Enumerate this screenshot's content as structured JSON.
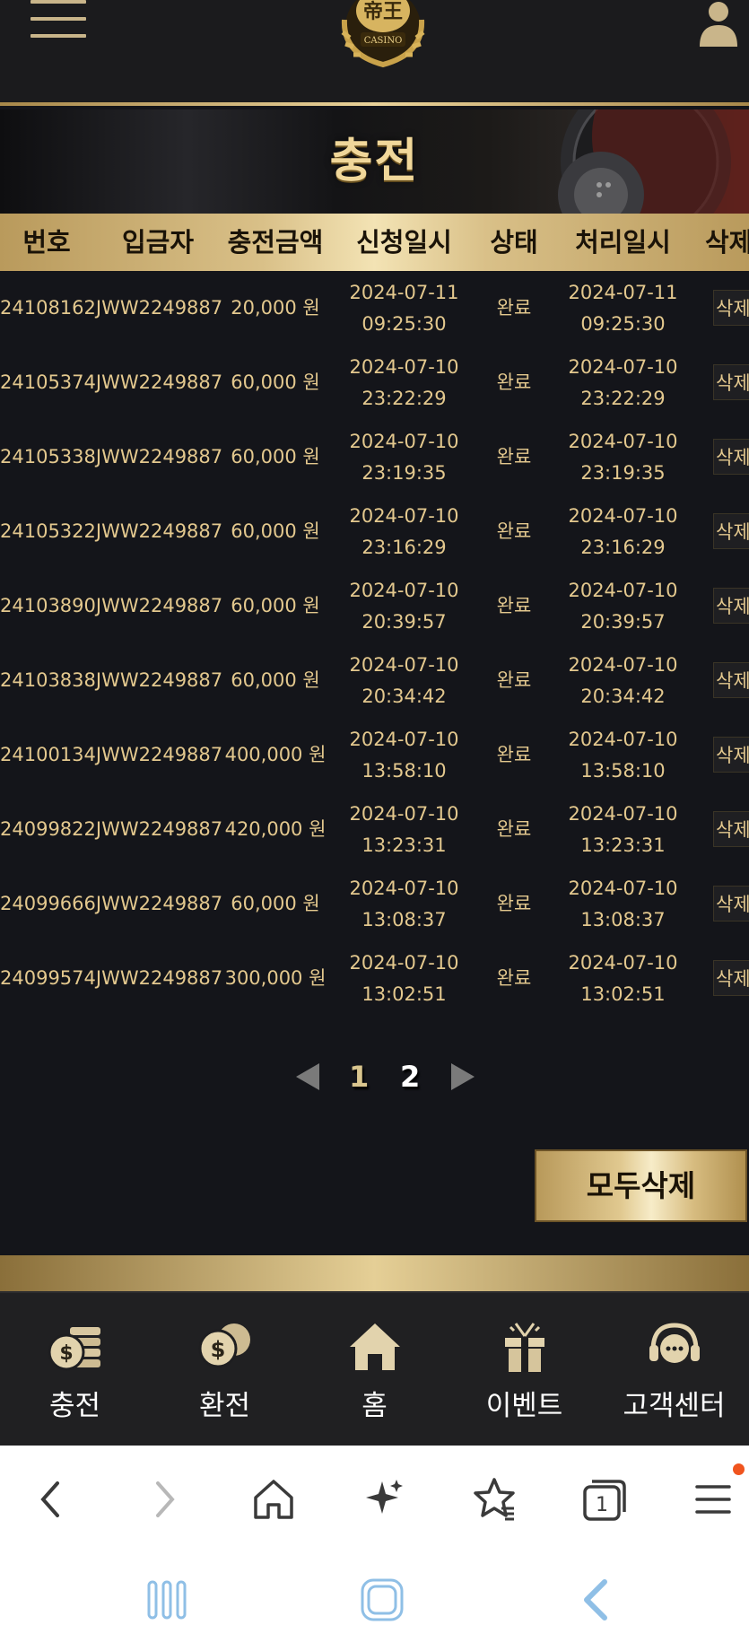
{
  "header": {
    "logo_text": "CASINO"
  },
  "banner": {
    "title": "충전"
  },
  "table": {
    "headers": [
      "번호",
      "입금자",
      "충전금액",
      "신청일시",
      "상태",
      "처리일시",
      "삭제"
    ],
    "rows": [
      {
        "id": "24108162JWW2249887",
        "amount": "20,000 원",
        "req_date": "2024-07-11",
        "req_time": "09:25:30",
        "status": "완료",
        "proc_date": "2024-07-11",
        "proc_time": "09:25:30",
        "delete": "삭제"
      },
      {
        "id": "24105374JWW2249887",
        "amount": "60,000 원",
        "req_date": "2024-07-10",
        "req_time": "23:22:29",
        "status": "완료",
        "proc_date": "2024-07-10",
        "proc_time": "23:22:29",
        "delete": "삭제"
      },
      {
        "id": "24105338JWW2249887",
        "amount": "60,000 원",
        "req_date": "2024-07-10",
        "req_time": "23:19:35",
        "status": "완료",
        "proc_date": "2024-07-10",
        "proc_time": "23:19:35",
        "delete": "삭제"
      },
      {
        "id": "24105322JWW2249887",
        "amount": "60,000 원",
        "req_date": "2024-07-10",
        "req_time": "23:16:29",
        "status": "완료",
        "proc_date": "2024-07-10",
        "proc_time": "23:16:29",
        "delete": "삭제"
      },
      {
        "id": "24103890JWW2249887",
        "amount": "60,000 원",
        "req_date": "2024-07-10",
        "req_time": "20:39:57",
        "status": "완료",
        "proc_date": "2024-07-10",
        "proc_time": "20:39:57",
        "delete": "삭제"
      },
      {
        "id": "24103838JWW2249887",
        "amount": "60,000 원",
        "req_date": "2024-07-10",
        "req_time": "20:34:42",
        "status": "완료",
        "proc_date": "2024-07-10",
        "proc_time": "20:34:42",
        "delete": "삭제"
      },
      {
        "id": "24100134JWW2249887",
        "amount": "400,000 원",
        "req_date": "2024-07-10",
        "req_time": "13:58:10",
        "status": "완료",
        "proc_date": "2024-07-10",
        "proc_time": "13:58:10",
        "delete": "삭제"
      },
      {
        "id": "24099822JWW2249887",
        "amount": "420,000 원",
        "req_date": "2024-07-10",
        "req_time": "13:23:31",
        "status": "완료",
        "proc_date": "2024-07-10",
        "proc_time": "13:23:31",
        "delete": "삭제"
      },
      {
        "id": "24099666JWW2249887",
        "amount": "60,000 원",
        "req_date": "2024-07-10",
        "req_time": "13:08:37",
        "status": "완료",
        "proc_date": "2024-07-10",
        "proc_time": "13:08:37",
        "delete": "삭제"
      },
      {
        "id": "24099574JWW2249887",
        "amount": "300,000 원",
        "req_date": "2024-07-10",
        "req_time": "13:02:51",
        "status": "완료",
        "proc_date": "2024-07-10",
        "proc_time": "13:02:51",
        "delete": "삭제"
      }
    ]
  },
  "pagination": {
    "pages": [
      "1",
      "2"
    ],
    "current": "2"
  },
  "actions": {
    "delete_all": "모두삭제"
  },
  "bottom_nav": [
    {
      "label": "충전",
      "icon": "coin-stack-icon"
    },
    {
      "label": "환전",
      "icon": "coins-icon"
    },
    {
      "label": "홈",
      "icon": "home-icon"
    },
    {
      "label": "이벤트",
      "icon": "gift-icon"
    },
    {
      "label": "고객센터",
      "icon": "headset-icon"
    }
  ],
  "browser_toolbar": [
    "back-icon",
    "forward-icon",
    "home-icon",
    "sparkle-icon",
    "bookmark-star-icon",
    "tabs-icon",
    "menu-icon"
  ],
  "browser_tab_count": "1",
  "colors": {
    "gold": "#e3c88e",
    "background": "#14151a",
    "header_bg": "#1b1b1d",
    "notification": "#f0541e"
  }
}
